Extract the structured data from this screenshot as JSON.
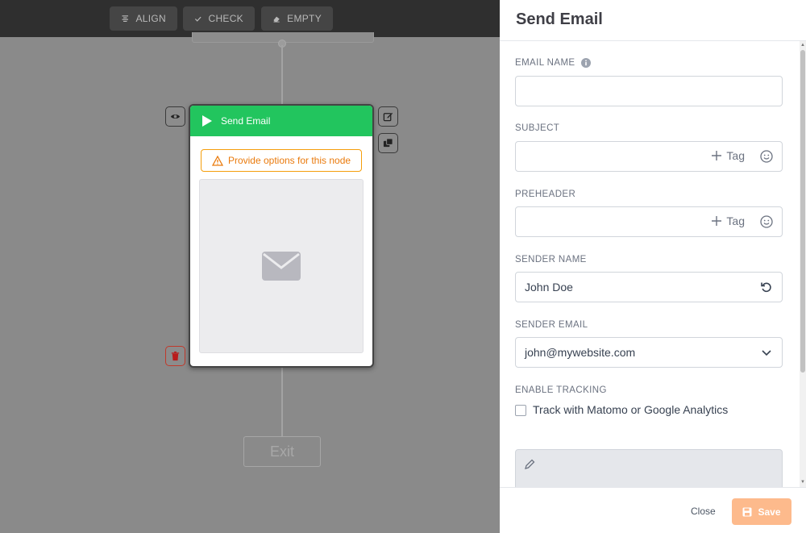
{
  "toolbar": {
    "align_label": "ALIGN",
    "check_label": "CHECK",
    "empty_label": "EMPTY"
  },
  "node": {
    "title": "Send Email",
    "warning": "Provide options for this node"
  },
  "exit_label": "Exit",
  "panel": {
    "title": "Send Email",
    "fields": {
      "email_name": {
        "label": "EMAIL NAME",
        "value": ""
      },
      "subject": {
        "label": "SUBJECT",
        "value": "",
        "tag_label": "Tag"
      },
      "preheader": {
        "label": "PREHEADER",
        "value": "",
        "tag_label": "Tag"
      },
      "sender_name": {
        "label": "SENDER NAME",
        "value": "John Doe"
      },
      "sender_email": {
        "label": "SENDER EMAIL",
        "value": "john@mywebsite.com"
      },
      "tracking": {
        "label": "ENABLE TRACKING",
        "checkbox_label": "Track with Matomo or Google Analytics",
        "checked": false
      }
    },
    "footer": {
      "close_label": "Close",
      "save_label": "Save"
    }
  },
  "colors": {
    "node_header": "#22c55e",
    "warning": "#ea7a0c",
    "save_button": "#fdba8c",
    "toolbar": "#2f2f2f"
  }
}
